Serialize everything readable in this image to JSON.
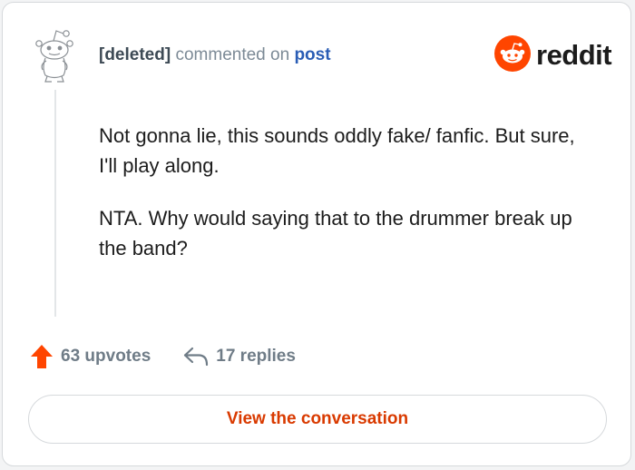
{
  "comment": {
    "author": "[deleted]",
    "action_text": "commented on",
    "post_link": "post",
    "paragraphs": [
      "Not gonna lie, this sounds oddly fake/ fanfic. But sure, I'll play along.",
      "NTA. Why would saying that to the drummer break up the band?"
    ]
  },
  "brand": {
    "name": "reddit",
    "icon": "reddit-snoo-icon",
    "color": "#ff4500"
  },
  "stats": {
    "upvotes_label": "63 upvotes",
    "replies_label": "17 replies",
    "upvote_icon": "upvote-arrow-icon",
    "reply_icon": "reply-arrow-icon"
  },
  "cta": {
    "label": "View the conversation",
    "color": "#d93a00"
  },
  "avatar": {
    "icon": "deleted-user-avatar-icon"
  }
}
